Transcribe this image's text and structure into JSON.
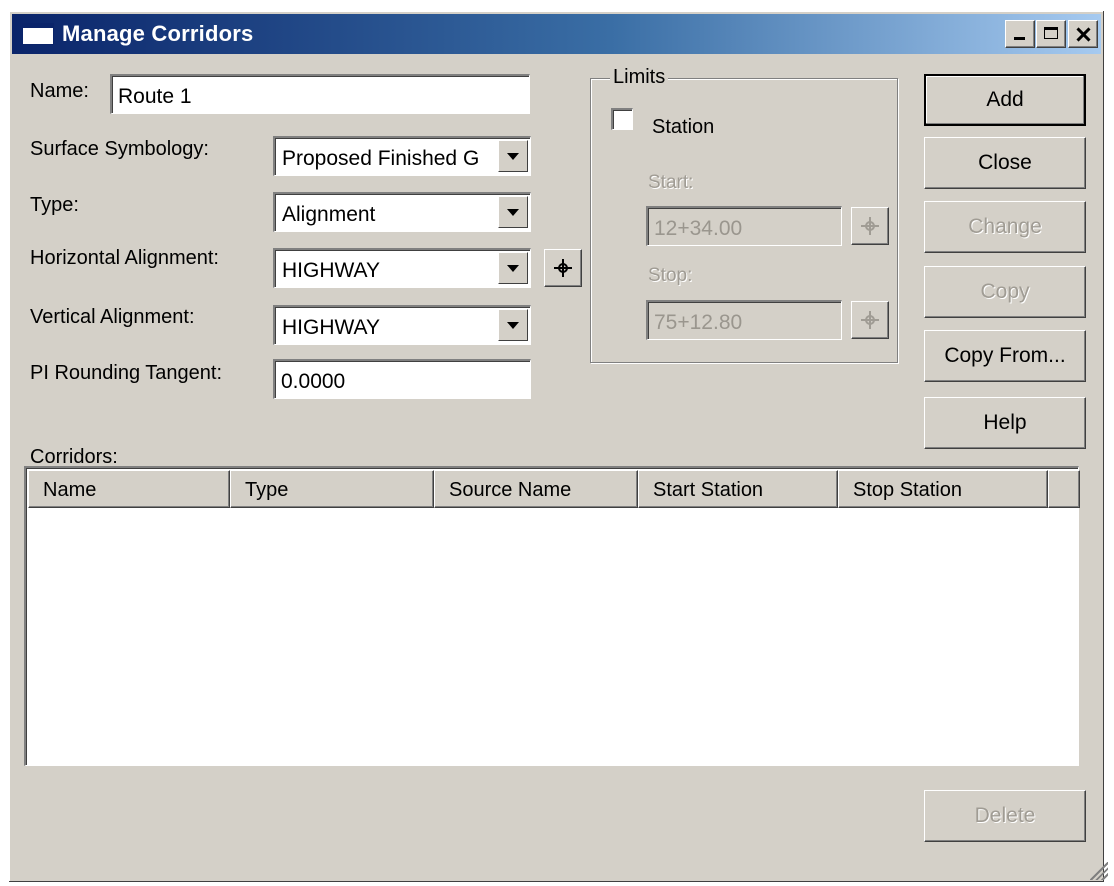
{
  "window": {
    "title": "Manage Corridors",
    "icon": "window-icon",
    "controls": [
      "minimize-icon",
      "maximize-icon",
      "close-icon"
    ]
  },
  "form": {
    "name_label": "Name:",
    "name_value": "Route 1",
    "surface_label": "Surface Symbology:",
    "surface_value": "Proposed Finished G",
    "type_label": "Type:",
    "type_value": "Alignment",
    "halign_label": "Horizontal Alignment:",
    "halign_value": "HIGHWAY",
    "valign_label": "Vertical Alignment:",
    "valign_value": "HIGHWAY",
    "pi_label": "PI Rounding Tangent:",
    "pi_value": "0.0000"
  },
  "limits": {
    "title": "Limits",
    "station_label": "Station",
    "station_checked": false,
    "start_label": "Start:",
    "start_value": "12+34.00",
    "stop_label": "Stop:",
    "stop_value": "75+12.80"
  },
  "buttons": {
    "add": "Add",
    "close": "Close",
    "change": "Change",
    "copy": "Copy",
    "copy_from": "Copy From...",
    "help": "Help",
    "delete": "Delete"
  },
  "corridors": {
    "label": "Corridors:",
    "columns": [
      "Name",
      "Type",
      "Source Name",
      "Start Station",
      "Stop Station"
    ],
    "rows": []
  },
  "colors": {
    "face": "#d4d0c8",
    "title_start": "#0a246a",
    "title_end": "#a6caf0",
    "disabled_text": "#a09c94"
  }
}
